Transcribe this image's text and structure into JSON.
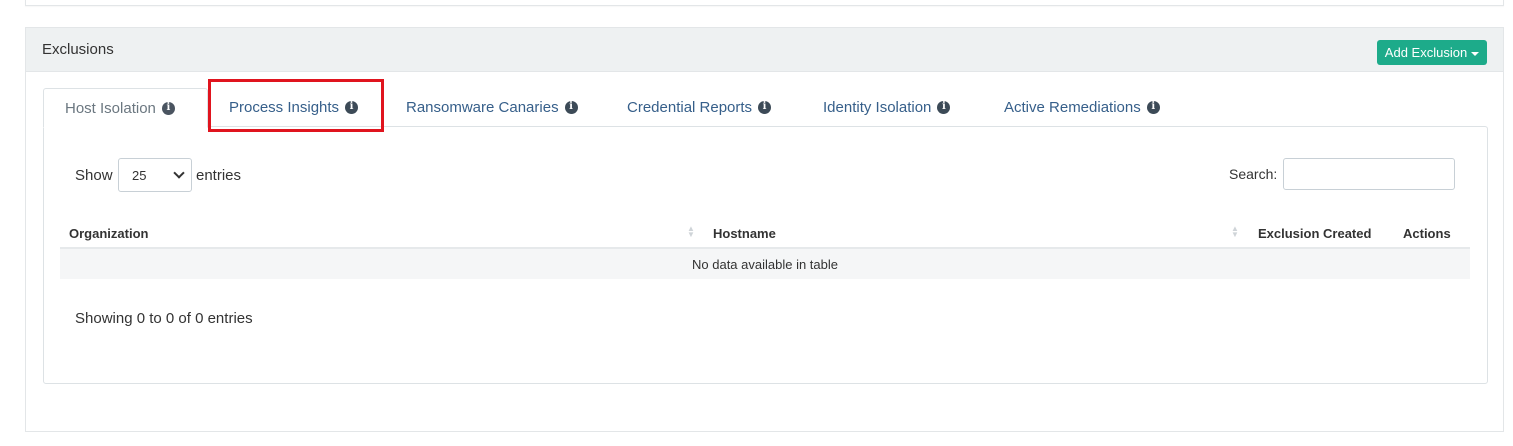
{
  "panel": {
    "title": "Exclusions",
    "add_button_label": "Add Exclusion"
  },
  "tabs": [
    {
      "label": "Host Isolation",
      "active": true
    },
    {
      "label": "Process Insights",
      "active": false,
      "highlighted": true
    },
    {
      "label": "Ransomware Canaries",
      "active": false
    },
    {
      "label": "Credential Reports",
      "active": false
    },
    {
      "label": "Identity Isolation",
      "active": false
    },
    {
      "label": "Active Remediations",
      "active": false
    }
  ],
  "table_controls": {
    "show_label": "Show",
    "entries_value": "25",
    "entries_label": "entries",
    "search_label": "Search:",
    "search_value": ""
  },
  "table": {
    "columns": [
      "Organization",
      "Hostname",
      "Exclusion Created",
      "Actions"
    ],
    "empty_message": "No data available in table",
    "info": "Showing 0 to 0 of 0 entries"
  },
  "colors": {
    "accent": "#1dab8a",
    "tab_link": "#365f8a",
    "highlight": "#e0141e"
  },
  "icons": {
    "info": "info-circle-icon",
    "caret": "caret-down-icon",
    "select_chevron": "chevron-down-icon",
    "sort": "sort-icon"
  }
}
